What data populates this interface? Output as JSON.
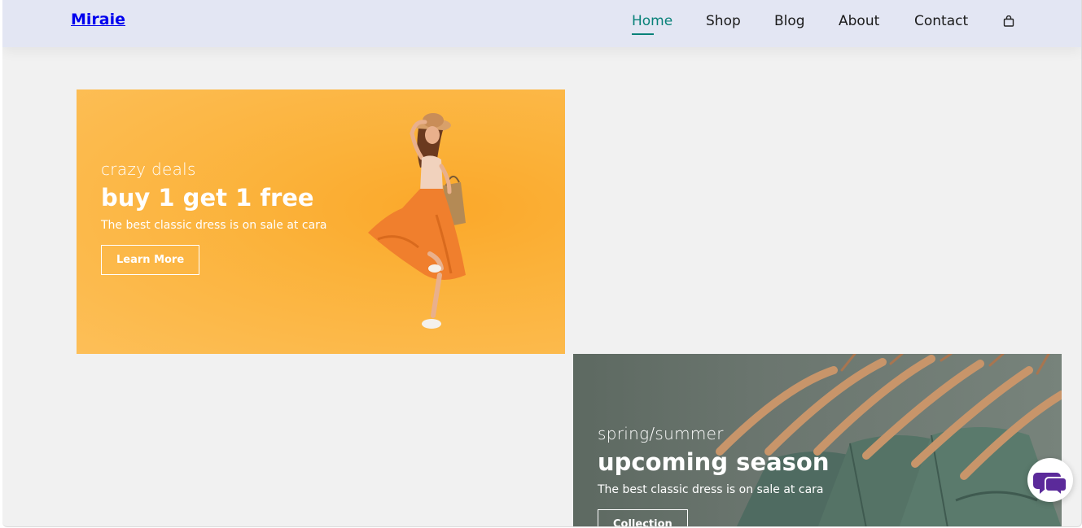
{
  "header": {
    "logo": "Miraie",
    "nav": [
      {
        "label": "Home",
        "active": true
      },
      {
        "label": "Shop",
        "active": false
      },
      {
        "label": "Blog",
        "active": false
      },
      {
        "label": "About",
        "active": false
      },
      {
        "label": "Contact",
        "active": false
      }
    ],
    "cart_icon": "shopping-bag-icon"
  },
  "banners": [
    {
      "subtitle": "crazy deals",
      "title": "buy 1 get 1 free",
      "description": "The best classic dress is on sale at cara",
      "button": "Learn More"
    },
    {
      "subtitle": "spring/summer",
      "title": "upcoming season",
      "description": "The best classic dress is on sale at cara",
      "button": "Collection"
    }
  ],
  "chat": {
    "icon": "chat-bubbles-icon"
  },
  "colors": {
    "accent": "#088178",
    "header_bg": "#e3e6f3",
    "banner_yellow": "#fbb23a",
    "banner_green": "#6b766f",
    "chat_purple": "#5b2a9a"
  }
}
